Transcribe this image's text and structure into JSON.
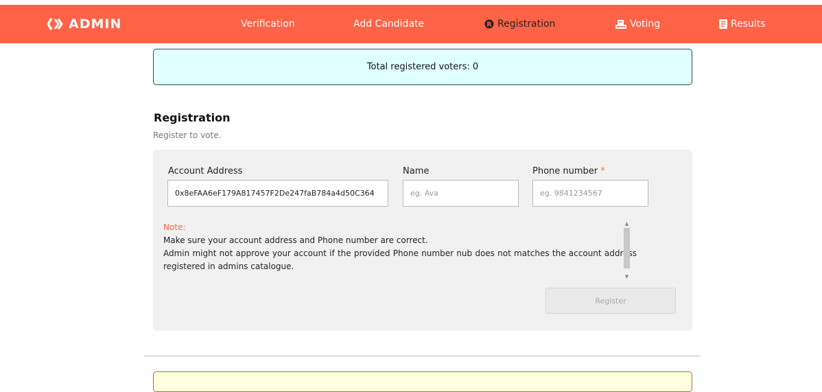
{
  "brand": {
    "label": "ADMIN"
  },
  "nav": {
    "items": [
      {
        "label": "Verification",
        "icon": ""
      },
      {
        "label": "Add Candidate",
        "icon": ""
      },
      {
        "label": "Registration",
        "icon": "registered-icon"
      },
      {
        "label": "Voting",
        "icon": "ballot-box-icon"
      },
      {
        "label": "Results",
        "icon": "results-icon"
      }
    ]
  },
  "info": {
    "text": "Total registered voters: 0"
  },
  "page": {
    "title": "Registration",
    "subtitle": "Register to vote."
  },
  "form": {
    "account_label": "Account Address",
    "account_value": "0x8eFAA6eF179A817457F2De247faB784a4d50C364",
    "name_label": "Name",
    "name_placeholder": "eg. Ava",
    "phone_label": "Phone number",
    "phone_required_mark": "*",
    "phone_placeholder": "eg. 9841234567",
    "note_title": "Note:",
    "note_line1": "Make sure your account address and Phone number are correct.",
    "note_line2": "Admin might not approve your account if the provided Phone number nub does not matches the account address registered in admins catalogue.",
    "register_label": "Register"
  },
  "colors": {
    "navbar": "#ff6347",
    "info_bg": "#e0ffff",
    "card_bg": "#f1f1f1",
    "warning_bg": "#ffffe0"
  }
}
